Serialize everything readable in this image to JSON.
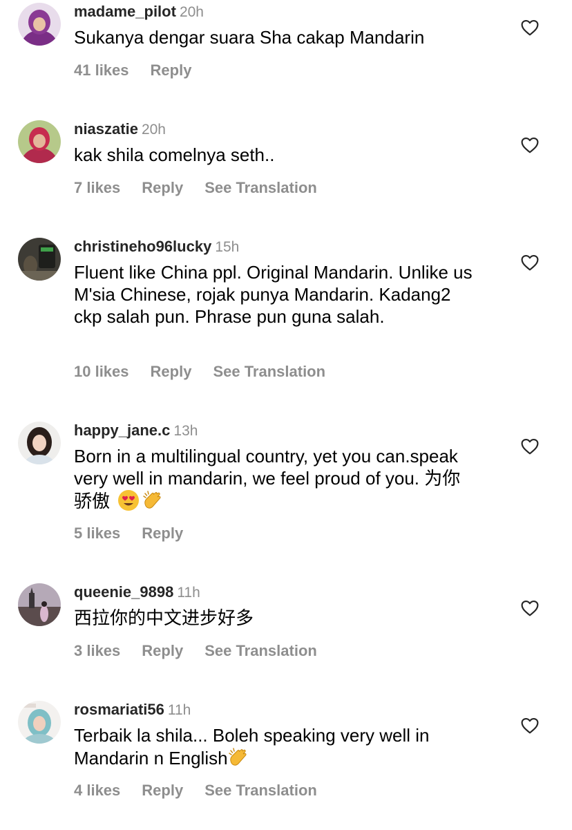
{
  "comments": [
    {
      "username": "madame_pilot",
      "time": "20h",
      "text": "Sukanya dengar suara Sha cakap Mandarin",
      "likes": "41 likes",
      "reply": "Reply",
      "translation": ""
    },
    {
      "username": "niaszatie",
      "time": "20h",
      "text": "kak shila comelnya seth..",
      "likes": "7 likes",
      "reply": "Reply",
      "translation": "See Translation"
    },
    {
      "username": "christineho96lucky",
      "time": "15h",
      "text": "Fluent like China ppl. Original Mandarin. Unlike us M'sia Chinese, rojak punya Mandarin. Kadang2 ckp salah pun. Phrase pun guna salah.",
      "likes": "10 likes",
      "reply": "Reply",
      "translation": "See Translation"
    },
    {
      "username": "happy_jane.c",
      "time": "13h",
      "text": "Born in a multilingual country,  yet you can.speak very well in mandarin, we feel proud of you. 为你骄傲",
      "emojis": [
        "heart-eyes",
        "clapping-hands"
      ],
      "likes": "5 likes",
      "reply": "Reply",
      "translation": ""
    },
    {
      "username": "queenie_9898",
      "time": "11h",
      "text": "西拉你的中文进步好多",
      "likes": "3 likes",
      "reply": "Reply",
      "translation": "See Translation"
    },
    {
      "username": "rosmariati56",
      "time": "11h",
      "text": "Terbaik la shila... Boleh speaking very well in Mandarin n English",
      "emojis": [
        "clapping-hands"
      ],
      "likes": "4 likes",
      "reply": "Reply",
      "translation": "See Translation"
    }
  ],
  "icons": {
    "like": "heart-outline-icon",
    "avatar": "profile-photo"
  },
  "colors": {
    "username": "#262626",
    "secondary": "#8e8e8e",
    "text": "#000000",
    "background": "#ffffff"
  }
}
